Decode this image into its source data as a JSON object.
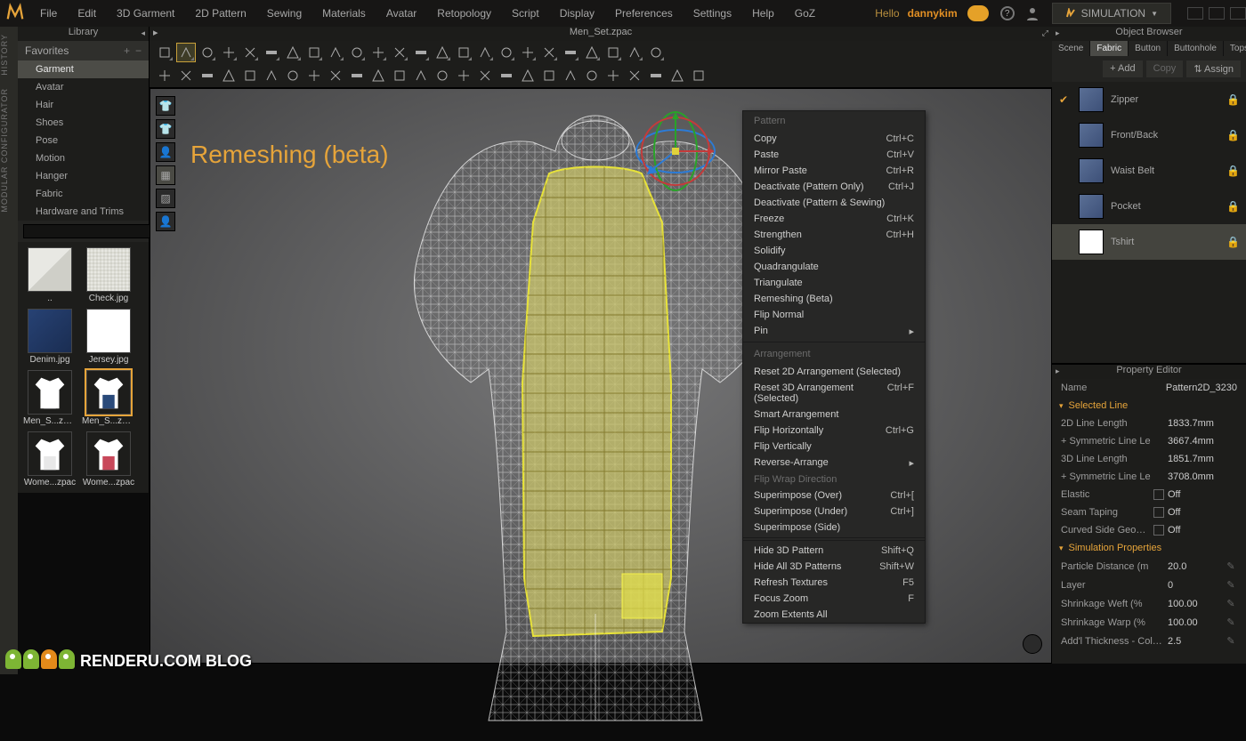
{
  "menus": [
    "File",
    "Edit",
    "3D Garment",
    "2D Pattern",
    "Sewing",
    "Materials",
    "Avatar",
    "Retopology",
    "Script",
    "Display",
    "Preferences",
    "Settings",
    "Help",
    "GoZ"
  ],
  "greeting": "Hello",
  "user": "dannykim",
  "mode_label": "SIMULATION",
  "left_rail": [
    "HISTORY",
    "MODULAR CONFIGURATOR"
  ],
  "library": {
    "title": "Library",
    "favorites": "Favorites",
    "tree": [
      "Garment",
      "Avatar",
      "Hair",
      "Shoes",
      "Pose",
      "Motion",
      "Hanger",
      "Fabric",
      "Hardware and Trims"
    ],
    "search_placeholder": "",
    "thumbs": [
      {
        "label": "..",
        "kind": "folder"
      },
      {
        "label": "Check.jpg",
        "kind": "check"
      },
      {
        "label": "Denim.jpg",
        "kind": "denim"
      },
      {
        "label": "Jersey.jpg",
        "kind": "jersey"
      },
      {
        "label": "Men_S...zpac",
        "kind": "garment1"
      },
      {
        "label": "Men_S...zpac",
        "kind": "garment2",
        "selected": true
      },
      {
        "label": "Wome...zpac",
        "kind": "garment3"
      },
      {
        "label": "Wome...zpac",
        "kind": "garment4"
      }
    ]
  },
  "document": "Men_Set.zpac",
  "overlay": "Remeshing (beta)",
  "context_menu": {
    "sections": [
      {
        "header": "Pattern",
        "items": [
          {
            "label": "Copy",
            "shortcut": "Ctrl+C"
          },
          {
            "label": "Paste",
            "shortcut": "Ctrl+V"
          },
          {
            "label": "Mirror Paste",
            "shortcut": "Ctrl+R"
          },
          {
            "label": "Deactivate (Pattern Only)",
            "shortcut": "Ctrl+J"
          },
          {
            "label": "Deactivate (Pattern & Sewing)",
            "shortcut": ""
          },
          {
            "label": "Freeze",
            "shortcut": "Ctrl+K"
          },
          {
            "label": "Strengthen",
            "shortcut": "Ctrl+H"
          },
          {
            "label": "Solidify",
            "shortcut": ""
          },
          {
            "label": "Quadrangulate",
            "shortcut": ""
          },
          {
            "label": "Triangulate",
            "shortcut": ""
          },
          {
            "label": "Remeshing (Beta)",
            "shortcut": ""
          },
          {
            "label": "Flip Normal",
            "shortcut": ""
          },
          {
            "label": "Pin",
            "shortcut": "",
            "submenu": true
          }
        ]
      },
      {
        "header": "Arrangement",
        "items": [
          {
            "label": "Reset 2D Arrangement (Selected)",
            "shortcut": ""
          },
          {
            "label": "Reset 3D Arrangement (Selected)",
            "shortcut": "Ctrl+F"
          },
          {
            "label": "Smart Arrangement",
            "shortcut": ""
          },
          {
            "label": "Flip Horizontally",
            "shortcut": "Ctrl+G"
          },
          {
            "label": "Flip Vertically",
            "shortcut": ""
          },
          {
            "label": "Reverse-Arrange",
            "shortcut": "",
            "submenu": true
          },
          {
            "label": "Flip Wrap Direction",
            "shortcut": "",
            "disabled": true
          },
          {
            "label": "Superimpose (Over)",
            "shortcut": "Ctrl+["
          },
          {
            "label": "Superimpose (Under)",
            "shortcut": "Ctrl+]"
          },
          {
            "label": "Superimpose (Side)",
            "shortcut": ""
          }
        ]
      },
      {
        "header": "",
        "items": [
          {
            "label": "Hide 3D Pattern",
            "shortcut": "Shift+Q"
          },
          {
            "label": "Hide All 3D Patterns",
            "shortcut": "Shift+W"
          },
          {
            "label": "Refresh Textures",
            "shortcut": "F5"
          },
          {
            "label": "Focus Zoom",
            "shortcut": "F"
          },
          {
            "label": "Zoom Extents All",
            "shortcut": ""
          }
        ]
      }
    ]
  },
  "object_browser": {
    "title": "Object Browser",
    "tabs": [
      "Scene",
      "Fabric",
      "Button",
      "Buttonhole",
      "Topstitch"
    ],
    "active_tab": 1,
    "toolbar": {
      "add": "+ Add",
      "copy": "Copy",
      "assign": "⇅ Assign"
    },
    "items": [
      {
        "name": "Zipper",
        "swatch": "denim",
        "checked": true
      },
      {
        "name": "Front/Back",
        "swatch": "denim"
      },
      {
        "name": "Waist Belt",
        "swatch": "denim"
      },
      {
        "name": "Pocket",
        "swatch": "denim"
      },
      {
        "name": "Tshirt",
        "swatch": "white",
        "selected": true
      }
    ]
  },
  "property_editor": {
    "title": "Property Editor",
    "name_label": "Name",
    "name_value": "Pattern2D_3230",
    "sections": [
      {
        "title": "Selected Line",
        "rows": [
          {
            "k": "2D Line Length",
            "v": "1833.7mm"
          },
          {
            "k": "+ Symmetric Line Le",
            "v": "3667.4mm"
          },
          {
            "k": "3D Line Length",
            "v": "1851.7mm"
          },
          {
            "k": "+ Symmetric Line Le",
            "v": "3708.0mm"
          },
          {
            "k": "Elastic",
            "v": "Off",
            "cb": true
          },
          {
            "k": "Seam Taping",
            "v": "Off",
            "cb": true
          },
          {
            "k": "Curved Side Geome",
            "v": "Off",
            "cb": true
          }
        ]
      },
      {
        "title": "Simulation Properties",
        "rows": [
          {
            "k": "Particle Distance (m",
            "v": "20.0",
            "tool": true
          },
          {
            "k": "Layer",
            "v": "0",
            "tool": true
          },
          {
            "k": "Shrinkage Weft (%",
            "v": "100.00",
            "tool": true
          },
          {
            "k": "Shrinkage Warp (%",
            "v": "100.00",
            "tool": true
          },
          {
            "k": "Add'l Thickness - Collisic",
            "v": "2.5",
            "tool": true
          }
        ]
      }
    ]
  },
  "watermark": "RENDERU.COM BLOG"
}
